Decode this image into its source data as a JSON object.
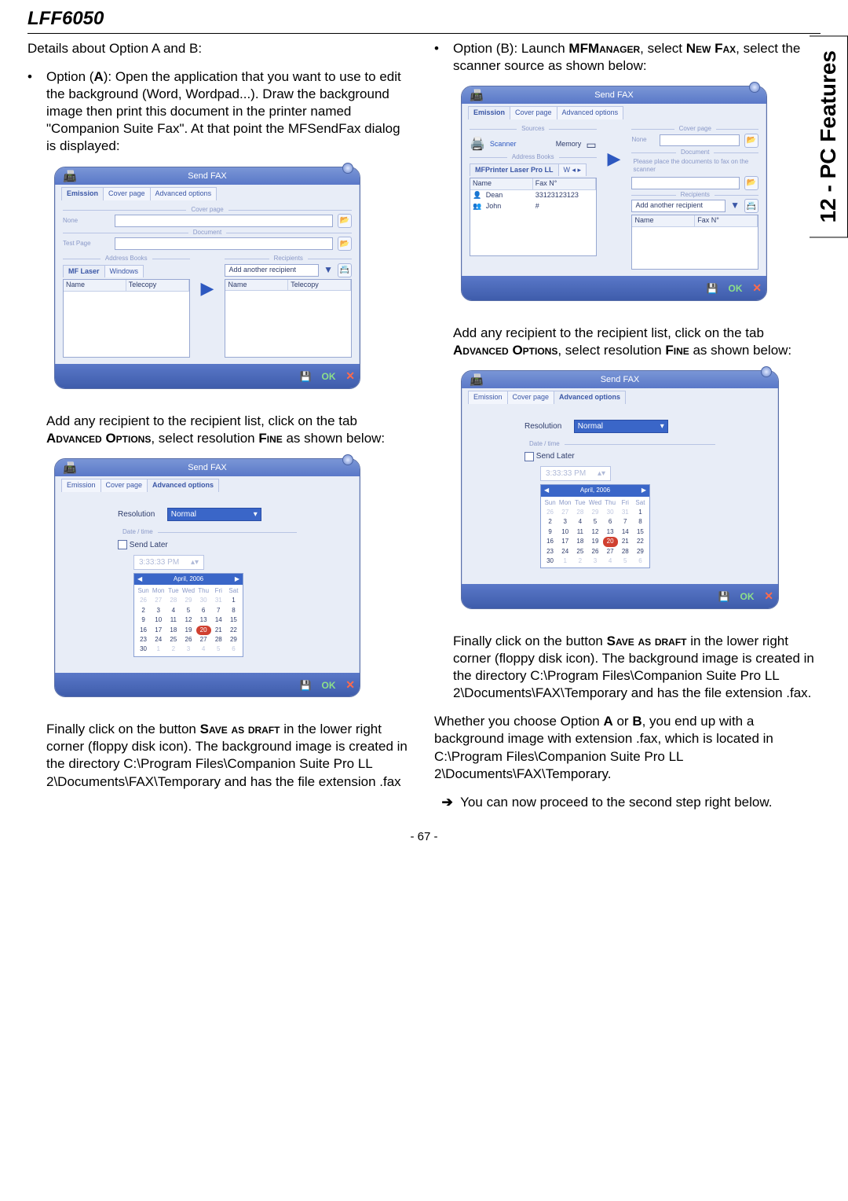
{
  "header": "LFF6050",
  "side_tab": "12 - PC Features",
  "page_number": "- 67 -",
  "left": {
    "intro": "Details about Option A and B:",
    "optA": "Option (A): Open the application that you want to use to edit the background (Word, Wordpad...). Draw the background image then print this document in the printer named \"Companion Suite Fax\". At that point the MFSendFax dialog is displayed:",
    "after_win1_a": "Add any recipient to the recipient list, click on the tab ",
    "advopt": "Advanced Options",
    "after_win1_b": ", select resolution ",
    "fine": "Fine",
    "after_win1_c": " as shown below:",
    "after_adv_a": "Finally click on the button ",
    "saveas": "Save as draft",
    "after_adv_b": " in the lower right corner (floppy disk icon). The background image is created in the directory C:\\Program Files\\Companion Suite Pro LL 2\\Documents\\FAX\\Temporary and has the file extension .fax"
  },
  "right": {
    "optB_a": "Option (B): Launch ",
    "mfm": "MFManager",
    "optB_b": ", select ",
    "newfax": "New Fax",
    "optB_c": ", select the scanner source as shown below:",
    "after_win2_a": "Add any recipient to the recipient list, click on the tab ",
    "after_adv_a": "Finally click on the button ",
    "after_adv_b": " in the lower right corner (floppy disk icon). The background image is created in the directory C:\\Program Files\\Companion Suite Pro LL 2\\Documents\\FAX\\Temporary and has the file extension .fax.",
    "whether": "Whether you choose Option A or B, you end up with a background image with extension .fax, which is located in C:\\Program Files\\Companion Suite Pro LL 2\\Documents\\FAX\\Temporary.",
    "proceed": "You can now proceed to the second step right below."
  },
  "win": {
    "title": "Send FAX",
    "tabs": {
      "emission": "Emission",
      "cover": "Cover page",
      "adv": "Advanced options"
    },
    "sources": "Sources",
    "none": "None",
    "memory": "Memory",
    "name": "Name",
    "testpage": "Test Page",
    "coverpage": "Cover page",
    "document": "Document",
    "scanner": "Scanner",
    "addrbooks": "Address Books",
    "recipients": "Recipients",
    "addanother": "Add another recipient",
    "telecopy": "Telecopy",
    "mflaser": "MF Laser",
    "windows": "Windows",
    "mfprinter": "MFPrinter Laser Pro LL",
    "faxnum": "Fax N°",
    "c_dean": "Dean",
    "c_dean_fax": "33123123123",
    "c_john": "John",
    "c_john_fax": "#",
    "please_scan": "Please place the documents to fax on the scanner",
    "ok": "OK",
    "res_label": "Resolution",
    "res_val": "Normal",
    "datetime": "Date / time",
    "sendlater": "Send Later",
    "time": "3:33:33 PM",
    "cal_title": "April, 2006",
    "days": [
      "Sun",
      "Mon",
      "Tue",
      "Wed",
      "Thu",
      "Fri",
      "Sat"
    ],
    "pre": [
      "26",
      "27",
      "28",
      "29",
      "30",
      "31"
    ],
    "dates": [
      "1",
      "2",
      "3",
      "4",
      "5",
      "6",
      "7",
      "8",
      "9",
      "10",
      "11",
      "12",
      "13",
      "14",
      "15",
      "16",
      "17",
      "18",
      "19",
      "20",
      "21",
      "22",
      "23",
      "24",
      "25",
      "26",
      "27",
      "28",
      "29",
      "30"
    ],
    "post": [
      "1",
      "2",
      "3",
      "4",
      "5",
      "6"
    ],
    "today": "20"
  }
}
